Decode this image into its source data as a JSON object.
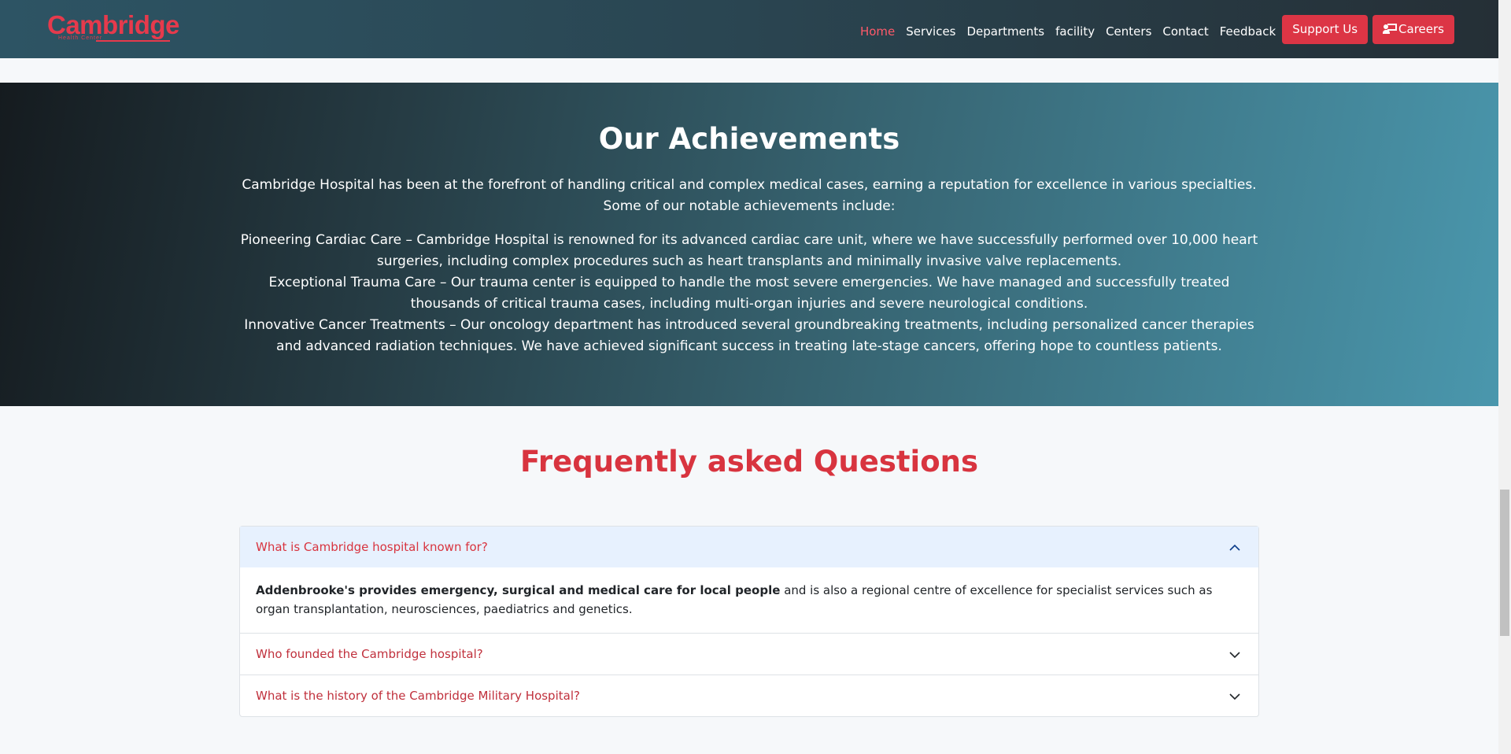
{
  "navbar": {
    "logo_text": "Cambridge",
    "logo_subtext": "Health Center",
    "links": [
      "Home",
      "Services",
      "Departments",
      "facility",
      "Centers",
      "Contact",
      "Feedback"
    ],
    "support_button": "Support Us",
    "careers_button": "Careers",
    "careers_icon": "chalkboard-teacher-icon",
    "accent_color": "#dc3545"
  },
  "achievements": {
    "title": "Our Achievements",
    "intro": "Cambridge Hospital has been at the forefront of handling critical and complex medical cases, earning a reputation for excellence in various specialties. Some of our notable achievements include:",
    "items": [
      "Pioneering Cardiac Care – Cambridge Hospital is renowned for its advanced cardiac care unit, where we have successfully performed over 10,000 heart surgeries, including complex procedures such as heart transplants and minimally invasive valve replacements.",
      "Exceptional Trauma Care – Our trauma center is equipped to handle the most severe emergencies. We have managed and successfully treated thousands of critical trauma cases, including multi-organ injuries and severe neurological conditions.",
      "Innovative Cancer Treatments – Our oncology department has introduced several groundbreaking treatments, including personalized cancer therapies and advanced radiation techniques. We have achieved significant success in treating late-stage cancers, offering hope to countless patients."
    ]
  },
  "faq": {
    "title": "Frequently asked Questions",
    "items": [
      {
        "question": "What is Cambridge hospital known for?",
        "answer_bold": "Addenbrooke's provides emergency, surgical and medical care for local people",
        "answer_rest": " and is also a regional centre of excellence for specialist services such as organ transplantation, neurosciences, paediatrics and genetics.",
        "expanded": true
      },
      {
        "question": "Who founded the Cambridge hospital?",
        "expanded": false
      },
      {
        "question": "What is the history of the Cambridge Military Hospital?",
        "expanded": false
      }
    ]
  }
}
